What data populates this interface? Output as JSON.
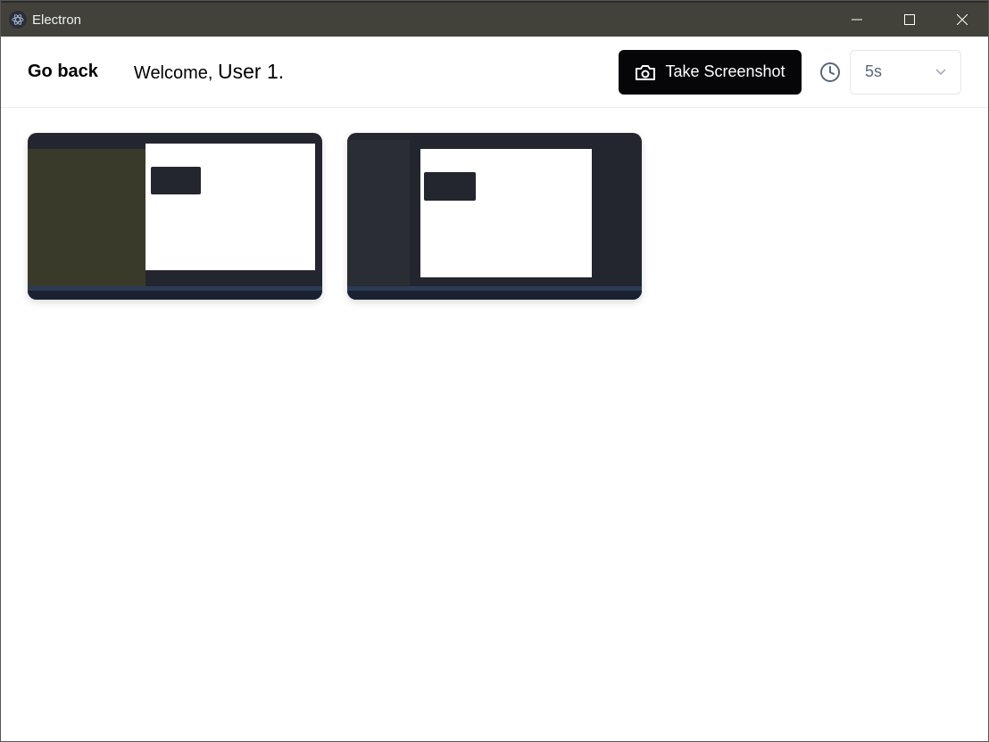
{
  "window": {
    "title": "Electron",
    "icon": "electron-icon",
    "controls": [
      "minimize-icon",
      "maximize-icon",
      "close-icon"
    ]
  },
  "header": {
    "go_back": "Go back",
    "welcome_prefix": "Welcome, ",
    "welcome_user": "User 1.",
    "take_screenshot": "Take Screenshot",
    "camera_icon": "camera-icon",
    "clock_icon": "clock-icon",
    "interval": {
      "selected": "5s",
      "icon": "chevron-down-icon"
    }
  },
  "gallery": {
    "thumbnails": [
      "screenshot-1",
      "screenshot-2"
    ]
  },
  "colors": {
    "titlebar": "#42423b",
    "button": "#060608"
  }
}
